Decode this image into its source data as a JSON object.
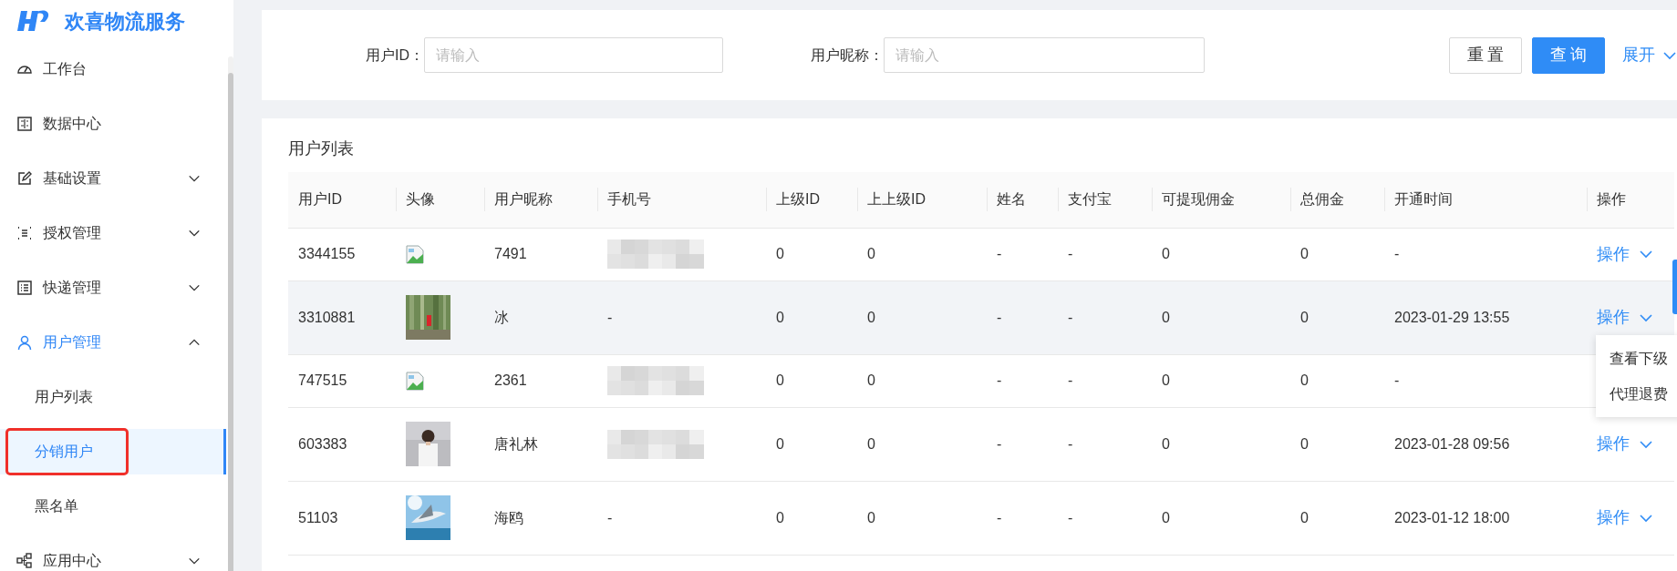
{
  "brand": {
    "title": "欢喜物流服务"
  },
  "sidebar": {
    "items": [
      {
        "label": "工作台",
        "selected": false
      },
      {
        "label": "数据中心",
        "selected": false
      },
      {
        "label": "基础设置",
        "expanded": false,
        "selected": false
      },
      {
        "label": "授权管理",
        "expanded": false,
        "selected": false
      },
      {
        "label": "快递管理",
        "expanded": false,
        "selected": false
      },
      {
        "label": "用户管理",
        "expanded": true,
        "selected": true,
        "children": [
          {
            "label": "用户列表",
            "selected": false,
            "highlighted": false
          },
          {
            "label": "分销用户",
            "selected": true,
            "highlighted": true
          },
          {
            "label": "黑名单",
            "selected": false,
            "highlighted": false
          }
        ]
      },
      {
        "label": "应用中心",
        "expanded": false,
        "selected": false
      }
    ]
  },
  "filters": [
    {
      "label": "用户ID：",
      "placeholder": "请输入"
    },
    {
      "label": "用户昵称：",
      "placeholder": "请输入"
    }
  ],
  "buttons": [
    {
      "label": "重置",
      "kind": "default"
    },
    {
      "label": "查询",
      "kind": "primary"
    }
  ],
  "expand_link": "展开",
  "table": {
    "title": "用户列表",
    "columns": [
      "用户ID",
      "头像",
      "用户昵称",
      "手机号",
      "上级ID",
      "上上级ID",
      "姓名",
      "支付宝",
      "可提现佣金",
      "总佣金",
      "开通时间",
      "操作"
    ],
    "rows": [
      {
        "id": "3344155",
        "avatar": {
          "kind": "broken"
        },
        "nickname": "7491",
        "phone": {
          "kind": "redacted"
        },
        "parent_id": "0",
        "grandparent_id": "0",
        "name": "-",
        "alipay": "-",
        "withdrawable": "0",
        "total": "0",
        "opened": "-",
        "action": "操作",
        "hovered": false
      },
      {
        "id": "3310881",
        "avatar": {
          "kind": "picture"
        },
        "nickname": "冰",
        "phone": {
          "kind": "text",
          "text": "-"
        },
        "parent_id": "0",
        "grandparent_id": "0",
        "name": "-",
        "alipay": "-",
        "withdrawable": "0",
        "total": "0",
        "opened": "2023-01-29 13:55",
        "action": "操作",
        "hovered": true,
        "menu": [
          "查看下级",
          "代理退费"
        ]
      },
      {
        "id": "747515",
        "avatar": {
          "kind": "broken"
        },
        "nickname": "2361",
        "phone": {
          "kind": "redacted"
        },
        "parent_id": "0",
        "grandparent_id": "0",
        "name": "-",
        "alipay": "-",
        "withdrawable": "0",
        "total": "0",
        "opened": "-",
        "hovered": false
      },
      {
        "id": "603383",
        "avatar": {
          "kind": "picture"
        },
        "nickname": "唐礼林",
        "phone": {
          "kind": "redacted"
        },
        "parent_id": "0",
        "grandparent_id": "0",
        "name": "-",
        "alipay": "-",
        "withdrawable": "0",
        "total": "0",
        "opened": "2023-01-28 09:56",
        "action": "操作",
        "hovered": false
      },
      {
        "id": "51103",
        "avatar": {
          "kind": "picture"
        },
        "nickname": "海鸥",
        "phone": {
          "kind": "text",
          "text": "-"
        },
        "parent_id": "0",
        "grandparent_id": "0",
        "name": "-",
        "alipay": "-",
        "withdrawable": "0",
        "total": "0",
        "opened": "2023-01-12 18:00",
        "action": "操作",
        "hovered": false
      }
    ]
  }
}
